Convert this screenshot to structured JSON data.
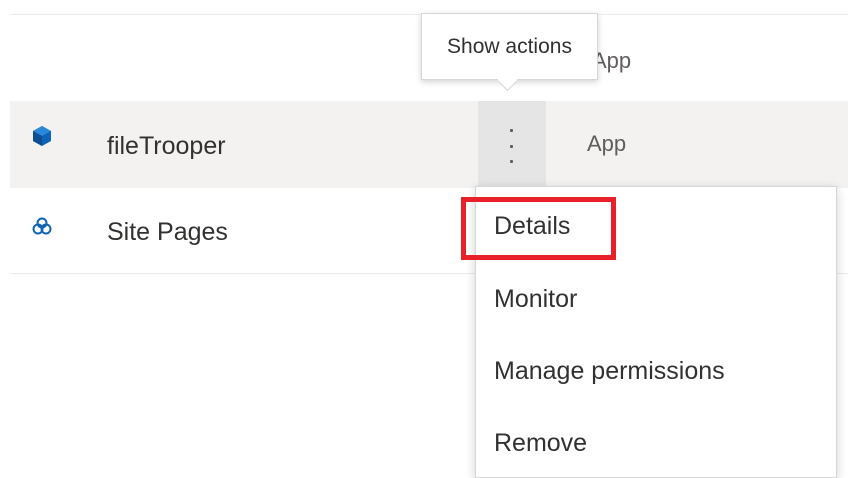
{
  "tooltip": {
    "text": "Show actions"
  },
  "list": {
    "hidden_type_label": "App",
    "rows": [
      {
        "name": "fileTrooper",
        "type": "App",
        "icon": "app-cube-icon",
        "selected": true
      },
      {
        "name": "Site Pages",
        "type": "",
        "icon": "site-pages-icon",
        "selected": false
      }
    ]
  },
  "context_menu": {
    "items": [
      {
        "label": "Details",
        "highlighted": true
      },
      {
        "label": "Monitor"
      },
      {
        "label": "Manage permissions"
      },
      {
        "label": "Remove"
      }
    ]
  },
  "colors": {
    "accent_blue": "#0f63b7",
    "highlight_red": "#e8202a",
    "selected_row_bg": "#f3f2f1"
  }
}
